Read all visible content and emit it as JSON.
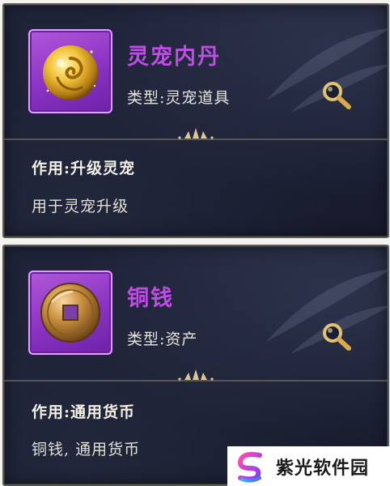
{
  "items": [
    {
      "name": "灵宠内丹",
      "type_line": "类型:灵宠道具",
      "effect_title": "作用:升级灵宠",
      "effect_desc": "用于灵宠升级",
      "icon": "golden-orb-icon",
      "name_color": "#c04ce6"
    },
    {
      "name": "铜钱",
      "type_line": "类型:资产",
      "effect_title": "作用:通用货币",
      "effect_desc": "铜钱, 通用货币",
      "icon": "copper-coin-icon",
      "name_color": "#c04ce6"
    }
  ],
  "watermark": {
    "text": "紫光软件园",
    "icon": "ziguang-logo-icon"
  },
  "colors": {
    "card_bg": "#1b1f33",
    "card_border": "#5b5a4e",
    "icon_frame": "#8a32c3",
    "text_primary": "#f3efe4",
    "search_icon": "#d9b86a"
  }
}
